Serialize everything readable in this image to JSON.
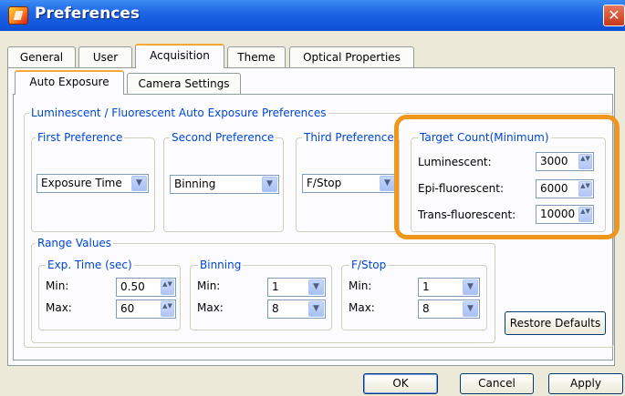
{
  "window": {
    "title": "Preferences",
    "app_icon": "app-logo-icon",
    "close_icon": "close-icon",
    "close_glyph": "✕"
  },
  "tabs": [
    "General",
    "User",
    "Acquisition",
    "Theme",
    "Optical Properties"
  ],
  "active_tab": "Acquisition",
  "subtabs": [
    "Auto Exposure",
    "Camera Settings"
  ],
  "active_subtab": "Auto Exposure",
  "auto_exposure": {
    "group_title": "Luminescent / Fluorescent Auto Exposure Preferences",
    "first_preference": {
      "label": "First Preference",
      "value": "Exposure Time"
    },
    "second_preference": {
      "label": "Second Preference",
      "value": "Binning"
    },
    "third_preference": {
      "label": "Third Preference",
      "value": "F/Stop"
    },
    "target_count": {
      "label": "Target Count(Minimum)",
      "luminescent": {
        "label": "Luminescent:",
        "value": "3000"
      },
      "epi": {
        "label": "Epi-fluorescent:",
        "value": "6000"
      },
      "trans": {
        "label": "Trans-fluorescent:",
        "value": "10000"
      }
    }
  },
  "range_values": {
    "label": "Range Values",
    "exp_time": {
      "label": "Exp. Time (sec)",
      "min_label": "Min:",
      "min": "0.50",
      "max_label": "Max:",
      "max": "60"
    },
    "binning": {
      "label": "Binning",
      "min_label": "Min:",
      "min": "1",
      "max_label": "Max:",
      "max": "8"
    },
    "fstop": {
      "label": "F/Stop",
      "min_label": "Min:",
      "min": "1",
      "max_label": "Max:",
      "max": "8"
    }
  },
  "restore_defaults_label": "Restore Defaults",
  "footer": {
    "ok": "OK",
    "cancel": "Cancel",
    "apply": "Apply"
  },
  "colors": {
    "title_bar": "#1f66e6",
    "group_label": "#0046d5",
    "highlight": "#f0961a"
  },
  "glyphs": {
    "dropdown": "▼",
    "spin": "▲▼"
  }
}
